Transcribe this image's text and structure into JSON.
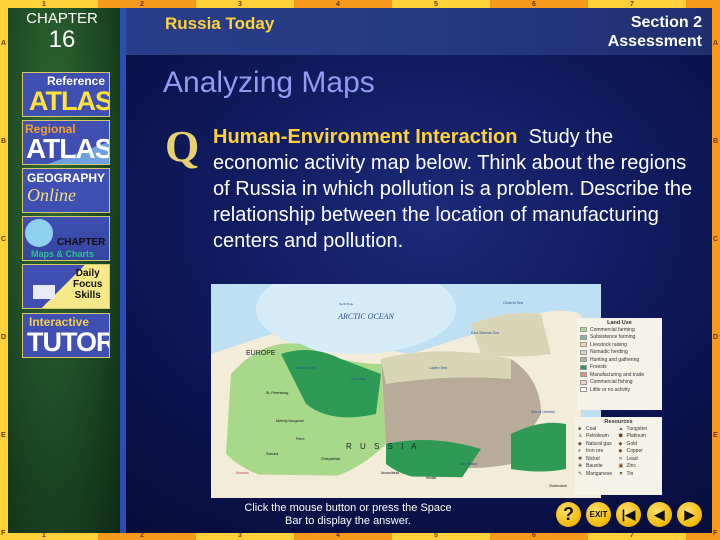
{
  "frame": {
    "top_ruler": [
      "1",
      "2",
      "3",
      "4",
      "5",
      "6",
      "7",
      "8"
    ],
    "side_ruler": [
      "A",
      "B",
      "C",
      "D",
      "E",
      "F"
    ]
  },
  "header": {
    "chapter_label": "CHAPTER",
    "chapter_number": "16",
    "chapter_title": "Russia Today",
    "section": "Section 2",
    "section_sub": "Assessment"
  },
  "sidebar": {
    "items": [
      {
        "line1": "Reference",
        "line2": "ATLAS"
      },
      {
        "line1": "Regional",
        "line2": "ATLAS"
      },
      {
        "line1": "GEOGRAPHY",
        "line2": "Online"
      },
      {
        "line1": "CHAPTER",
        "line2": "Maps & Charts"
      },
      {
        "line1": "Daily",
        "line2": "Focus",
        "line3": "Skills"
      },
      {
        "line1": "Interactive",
        "line2": "TUTOR"
      }
    ]
  },
  "main": {
    "title": "Analyzing Maps",
    "q_glyph": "Q",
    "question_heading": "Human-Environment Interaction",
    "question_body": "Study the economic activity map below. Think about the regions of Russia in which pollution is a problem. Describe the relationship between the location of manufacturing centers and pollution."
  },
  "map": {
    "labels": {
      "ocean": "ARCTIC OCEAN",
      "europe": "EUROPE",
      "russia": "R U S S I A",
      "pole": "North Pole",
      "barents": "Barents Sea",
      "kara": "Kara Sea",
      "laptev": "Laptev Sea",
      "okhotsk": "Sea of Okhotsk",
      "stpete": "St. Petersburg",
      "moscow": "Moscow",
      "novgorod": "Nizhniy Novgorod",
      "perm": "Perm",
      "samara": "Samara",
      "chelyabinsk": "Chelyabinsk",
      "novosibirsk": "Novosibirsk",
      "irkutsk": "Irkutsk",
      "vladivostok": "Vladivostok",
      "eastsib": "East Siberian Sea",
      "chukchi": "Chukchi Sea",
      "baikal": "Lake Baikal"
    },
    "land_use": {
      "title": "Land Use",
      "items": [
        {
          "label": "Commercial farming",
          "color": "#a8d88a"
        },
        {
          "label": "Subsistence farming",
          "color": "#7fb8a0"
        },
        {
          "label": "Livestock raising",
          "color": "#f3d9a0"
        },
        {
          "label": "Nomadic herding",
          "color": "#d9d6b8"
        },
        {
          "label": "Hunting and gathering",
          "color": "#b8ab98"
        },
        {
          "label": "Forests",
          "color": "#2e9a55"
        },
        {
          "label": "Manufacturing and trade",
          "color": "#e88a78"
        },
        {
          "label": "Commercial fishing",
          "color": "#f2cfc6"
        },
        {
          "label": "Little or no activity",
          "color": "#ffffff"
        }
      ]
    },
    "resources": {
      "title": "Resources",
      "items": [
        {
          "label": "Coal",
          "glyph": "■"
        },
        {
          "label": "Tungsten",
          "glyph": "▲"
        },
        {
          "label": "Petroleum",
          "glyph": "♙"
        },
        {
          "label": "Platinum",
          "glyph": "⬢"
        },
        {
          "label": "Natural gas",
          "glyph": "◆"
        },
        {
          "label": "Gold",
          "glyph": "◆"
        },
        {
          "label": "Iron ore",
          "glyph": "≡"
        },
        {
          "label": "Copper",
          "glyph": "◆"
        },
        {
          "label": "Nickel",
          "glyph": "✱"
        },
        {
          "label": "Lead",
          "glyph": "✕"
        },
        {
          "label": "Bauxite",
          "glyph": "✚"
        },
        {
          "label": "Zinc",
          "glyph": "▣"
        },
        {
          "label": "Manganese",
          "glyph": "✎"
        },
        {
          "label": "Tin",
          "glyph": "▼"
        }
      ]
    }
  },
  "footer": {
    "hint": "Click the mouse button or press the Space Bar to display the answer.",
    "help": "?",
    "exit": "EXIT"
  },
  "colors": {
    "accent": "#ffd23a",
    "title": "#8f9cf0",
    "background": "#0b1450"
  }
}
